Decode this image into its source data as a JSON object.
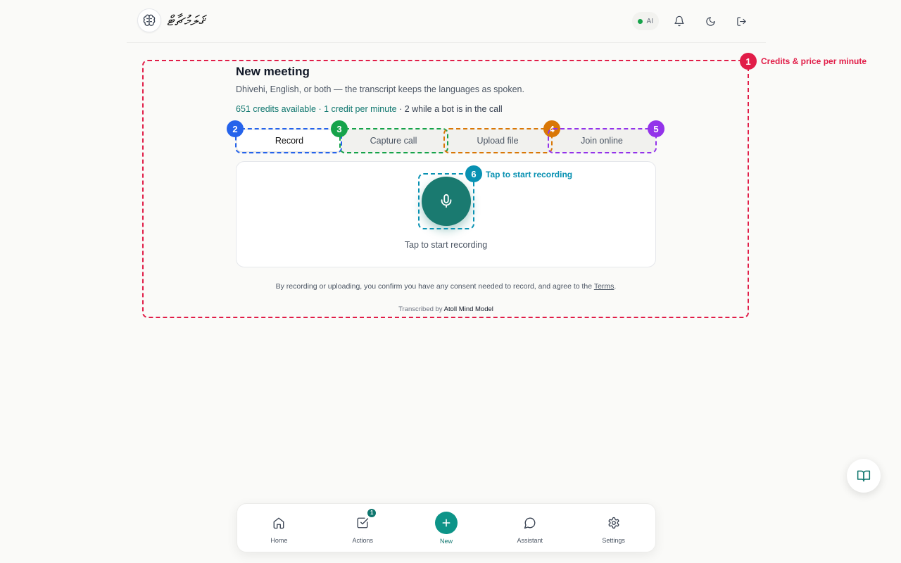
{
  "header": {
    "brand_text": "ޤަލަމުޗާޓް",
    "ai_status": "AI"
  },
  "main": {
    "title": "New meeting",
    "subtitle": "Dhivehi, English, or both — the transcript keeps the languages as spoken.",
    "credits_available": "651 credits available",
    "credits_rate": " · 1 credit per minute",
    "credits_bot": " · 2 while a bot is in the call",
    "tabs": [
      {
        "label": "Record"
      },
      {
        "label": "Capture call"
      },
      {
        "label": "Upload file"
      },
      {
        "label": "Join online"
      }
    ],
    "record_caption": "Tap to start recording",
    "consent_text": "By recording or uploading, you confirm you have any consent needed to record, and agree to the ",
    "terms_link": "Terms",
    "consent_end": ".",
    "transcribed_prefix": "Transcribed by ",
    "model_name": "Atoll Mind Model"
  },
  "annotations": [
    {
      "num": "1",
      "label": "Credits & price per minute",
      "color": "#e11d48"
    },
    {
      "num": "2",
      "color": "#2563eb"
    },
    {
      "num": "3",
      "color": "#16a34a"
    },
    {
      "num": "4",
      "color": "#d97706"
    },
    {
      "num": "5",
      "color": "#9333ea"
    },
    {
      "num": "6",
      "label": "Tap to start recording",
      "color": "#0891b2"
    }
  ],
  "bottom_nav": {
    "items": [
      {
        "label": "Home"
      },
      {
        "label": "Actions",
        "badge": "1"
      },
      {
        "label": "New"
      },
      {
        "label": "Assistant"
      },
      {
        "label": "Settings"
      }
    ]
  },
  "colors": {
    "accent": "#0f766e",
    "record_button": "#1a7a70"
  }
}
